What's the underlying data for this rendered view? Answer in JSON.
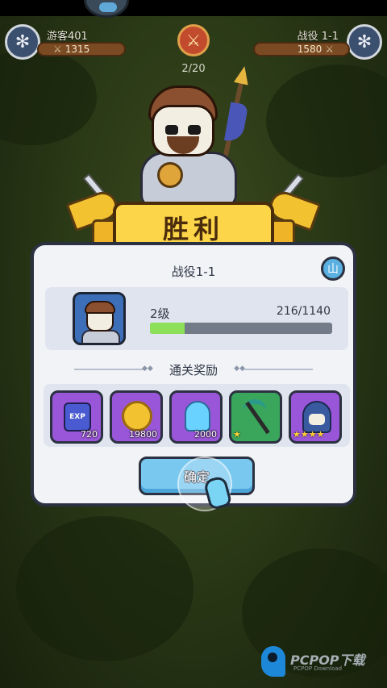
{
  "header": {
    "player_left": {
      "name": "游客401",
      "power": "1315"
    },
    "player_right": {
      "name": "战役 1-1",
      "power": "1580"
    },
    "round_counter": "2/20"
  },
  "banner": {
    "title": "胜利"
  },
  "panel": {
    "title": "战役1-1",
    "corner_icon": "山",
    "hero": {
      "level": "2级",
      "exp_text": "216/1140",
      "exp_fraction": 0.19
    },
    "rewards_title": "通关奖励",
    "rewards": [
      {
        "icon": "exp-potion-icon",
        "badge": "EXP",
        "qty": "720",
        "color": "purple"
      },
      {
        "icon": "gold-coin-icon",
        "qty": "19800",
        "color": "purple"
      },
      {
        "icon": "spirit-ghost-icon",
        "qty": "2000",
        "color": "purple"
      },
      {
        "icon": "scythe-weapon-icon",
        "stars": "★",
        "color": "green"
      },
      {
        "icon": "mage-hero-icon",
        "stars": "★★★★",
        "color": "purple"
      }
    ],
    "confirm_label": "确定"
  },
  "watermark": {
    "brand": "PCPOP下载",
    "sub": "PCPOP Download"
  },
  "colors": {
    "accent": "#78c8f0",
    "banner": "#fcd548",
    "exp_fill": "#8de05a"
  }
}
